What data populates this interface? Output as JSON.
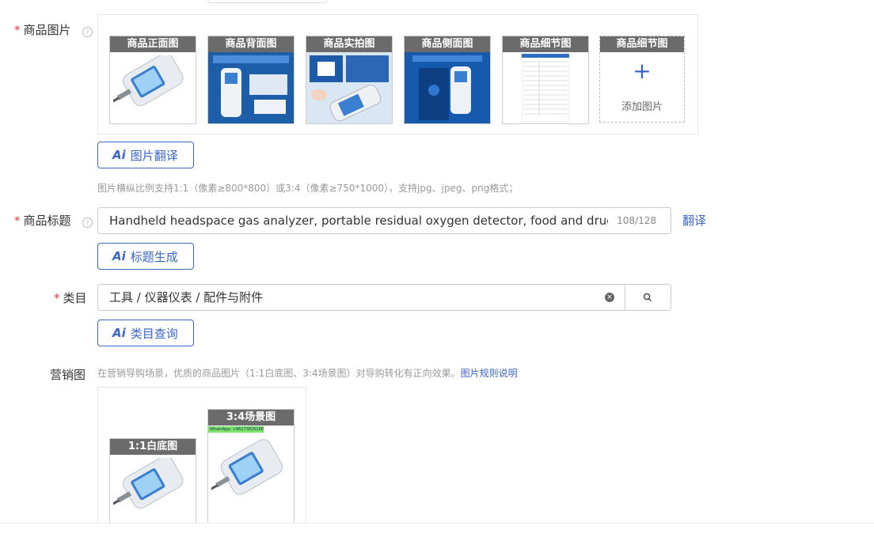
{
  "main_images": {
    "label": "商品图片",
    "required": "*",
    "thumbnails": [
      {
        "caption": "商品正面图"
      },
      {
        "caption": "商品背面图"
      },
      {
        "caption": "商品实拍图"
      },
      {
        "caption": "商品侧面图"
      },
      {
        "caption": "商品细节图"
      },
      {
        "caption": "商品细节图"
      }
    ],
    "add_label": "添加图片",
    "translate_button": "图片翻译",
    "hint": "图片横纵比例支持1:1（像素≥800*800）或3:4（像素≥750*1000），支持jpg、jpeg、png格式；"
  },
  "title_field": {
    "label": "商品标题",
    "required": "*",
    "value": "Handheld headspace gas analyzer, portable residual oxygen detector, food and drug packaging",
    "counter": "108/128",
    "translate_link": "翻译",
    "generate_button": "标题生成"
  },
  "category": {
    "label": "类目",
    "required": "*",
    "value": "工具 / 仪器仪表 / 配件与附件",
    "query_button": "类目查询"
  },
  "marketing": {
    "label": "营销图",
    "hint": "在营销导购场景，优质的商品图片（1:1白底图、3:4场景图）对导购转化有正向效果。",
    "rule_link": "图片规则说明",
    "square_caption": "1:1白底图",
    "scene_caption": "3:4场景图",
    "scene_watermark": "WhatsApp: +8617382616825"
  },
  "ai_badge": "Ai"
}
